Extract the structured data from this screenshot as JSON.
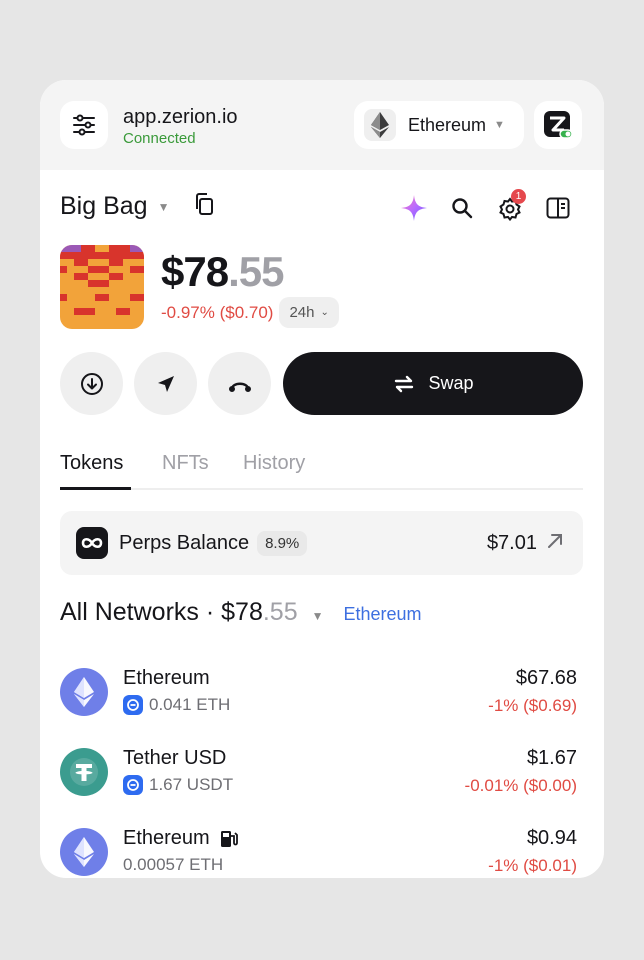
{
  "site": {
    "domain": "app.zerion.io",
    "status": "Connected"
  },
  "network": {
    "name": "Ethereum"
  },
  "wallet": {
    "name": "Big Bag",
    "balance_main": "$78",
    "balance_cents": ".55",
    "change": "-0.97% ($0.70)",
    "period": "24h",
    "notification_count": "1"
  },
  "actions": {
    "swap_label": "Swap"
  },
  "tabs": [
    {
      "label": "Tokens"
    },
    {
      "label": "NFTs"
    },
    {
      "label": "History"
    }
  ],
  "perps": {
    "label": "Perps Balance",
    "percent": "8.9%",
    "value": "$7.01"
  },
  "networks": {
    "title_main": "All Networks · $78",
    "title_cents": ".55",
    "filter": "Ethereum"
  },
  "tokens": [
    {
      "name": "Ethereum",
      "amount": "0.041 ETH",
      "value": "$67.68",
      "change": "-1% ($0.69)"
    },
    {
      "name": "Tether USD",
      "amount": "1.67 USDT",
      "value": "$1.67",
      "change": "-0.01% ($0.00)"
    },
    {
      "name": "Ethereum",
      "amount": "0.00057 ETH",
      "value": "$0.94",
      "change": "-1% ($0.01)"
    }
  ],
  "colors": {
    "accent_green": "#3a9a3a",
    "negative": "#e04b43",
    "link_blue": "#3d6fe0",
    "eth_purple": "#6f7fe8",
    "tether_teal": "#3b9c8f"
  }
}
